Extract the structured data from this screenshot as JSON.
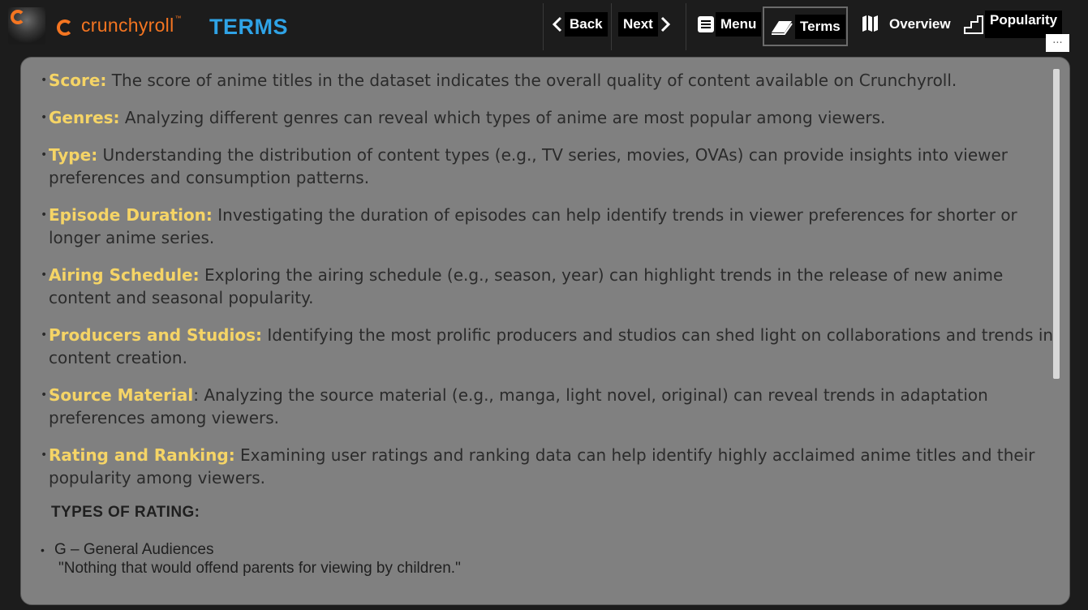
{
  "header": {
    "brand": "crunchyroll",
    "brand_tm": "™",
    "page_title": "TERMS",
    "accent_color": "#f47521",
    "title_color": "#2fa3e6"
  },
  "nav": {
    "back": "Back",
    "next": "Next",
    "menu": "Menu",
    "terms": "Terms",
    "overview": "Overview",
    "popularity": "Popularity",
    "more": "..."
  },
  "terms": [
    {
      "key": "Score:",
      "text": " The  score of anime titles in the dataset indicates the overall quality of content available on Crunchyroll."
    },
    {
      "key": "Genres:",
      "text": " Analyzing different genres can reveal which types of anime are most popular among viewers."
    },
    {
      "key": "Type:",
      "text": " Understanding the distribution of content types (e.g., TV series, movies, OVAs) can provide insights into viewer preferences and consumption patterns."
    },
    {
      "key": "Episode Duration:",
      "text": " Investigating the duration of episodes can help identify trends in viewer preferences for shorter or longer anime series."
    },
    {
      "key": "Airing Schedule:",
      "text": " Exploring the airing schedule (e.g., season, year) can highlight trends in the release of new anime content and seasonal popularity."
    },
    {
      "key": "Producers and Studios:",
      "text": " Identifying the most prolific producers and studios can shed light on collaborations and trends in content creation."
    },
    {
      "key": "Source Material",
      "text": ": Analyzing the source material (e.g., manga, light novel, original) can reveal trends in adaptation preferences among viewers."
    },
    {
      "key": "Rating and Ranking:",
      "text": " Examining user ratings and ranking data can help identify highly acclaimed anime titles and their popularity among viewers."
    }
  ],
  "ratings": {
    "heading": "TYPES OF RATING:",
    "items": [
      {
        "label": "G – General Audiences",
        "desc": "\"Nothing that would offend parents for viewing by children.\""
      }
    ]
  }
}
